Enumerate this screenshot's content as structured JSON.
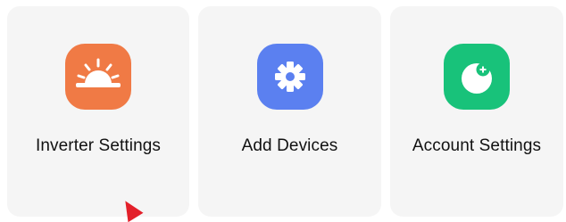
{
  "cards": [
    {
      "label": "Inverter Settings",
      "icon": "sunrise-icon",
      "color": "#f07a45"
    },
    {
      "label": "Add Devices",
      "icon": "gear-icon",
      "color": "#5b80f0"
    },
    {
      "label": "Account Settings",
      "icon": "account-add-icon",
      "color": "#18c27a"
    }
  ],
  "pointer_color": "#e3202a"
}
